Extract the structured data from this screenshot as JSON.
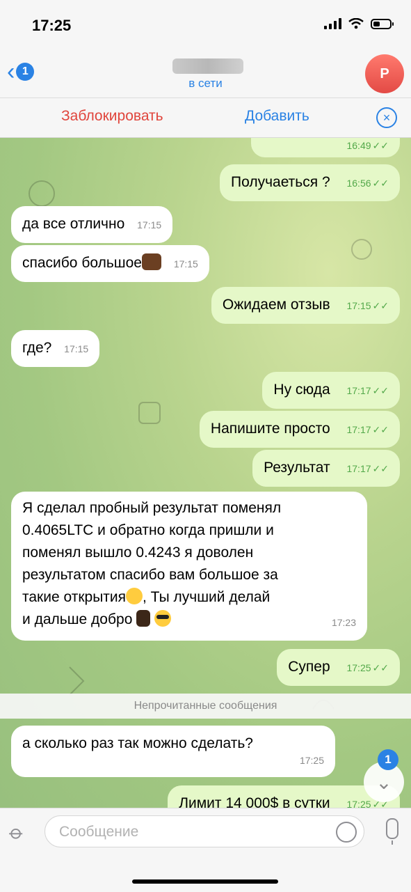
{
  "status_bar": {
    "time": "17:25"
  },
  "header": {
    "back_badge": "1",
    "subtitle": "в сети",
    "avatar_letter": "Р"
  },
  "actions": {
    "block": "Заблокировать",
    "add": "Добавить"
  },
  "messages": [
    {
      "dir": "out",
      "text": "",
      "time": "16:49"
    },
    {
      "dir": "out",
      "text": "Получаеться ?",
      "time": "16:56"
    },
    {
      "dir": "in",
      "text": "да все отлично",
      "time": "17:15"
    },
    {
      "dir": "in",
      "text": "спасибо большое",
      "time": "17:15"
    },
    {
      "dir": "out",
      "text": "Ожидаем отзыв",
      "time": "17:15"
    },
    {
      "dir": "in",
      "text": "где?",
      "time": "17:15"
    },
    {
      "dir": "out",
      "text": "Ну сюда",
      "time": "17:17"
    },
    {
      "dir": "out",
      "text": "Напишите просто",
      "time": "17:17"
    },
    {
      "dir": "out",
      "text": "Результат",
      "time": "17:17"
    },
    {
      "dir": "in",
      "lines": [
        "Я сделал пробный результат поменял",
        "0.4065LTC и обратно когда пришли и",
        "поменял вышло 0.4243 я доволен",
        "результатом спасибо вам большое за",
        "такие открытия",
        ", Ты лучший делай",
        "и дальше добро"
      ],
      "time": "17:23"
    },
    {
      "dir": "out",
      "text": "Супер",
      "time": "17:25"
    },
    {
      "dir": "in",
      "text": "а сколько раз так можно сделать?",
      "time": "17:25"
    },
    {
      "dir": "out",
      "text": "Лимит 14 000$ в сутки",
      "time": "17:25"
    }
  ],
  "unread_divider": "Непрочитанные сообщения",
  "scroll_badge": "1",
  "composer": {
    "placeholder": "Сообщение"
  }
}
